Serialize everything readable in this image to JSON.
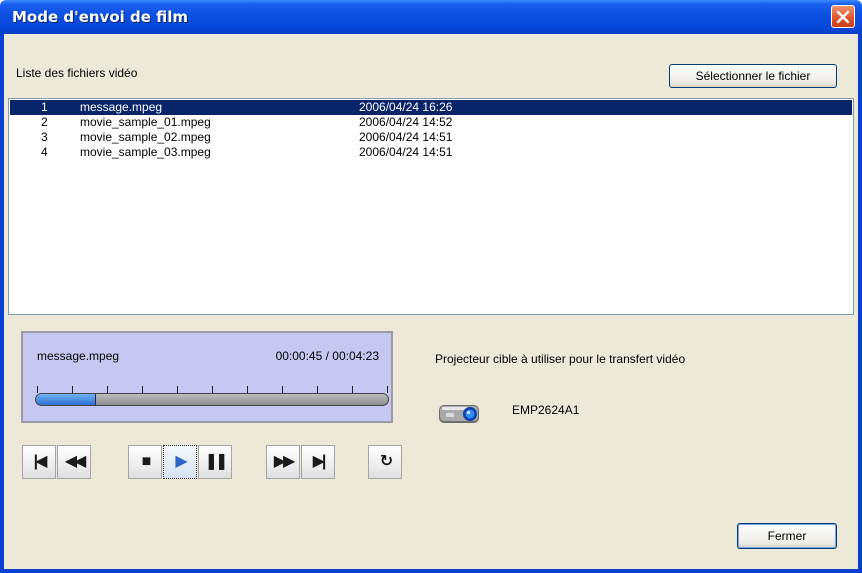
{
  "window": {
    "title": "Mode d'envoi de film"
  },
  "files": {
    "label": "Liste des fichiers vidéo",
    "select_button": "Sélectionner le fichier",
    "rows": [
      {
        "num": "1",
        "name": "message.mpeg",
        "date": "2006/04/24 16:26",
        "selected": true
      },
      {
        "num": "2",
        "name": "movie_sample_01.mpeg",
        "date": "2006/04/24 14:52",
        "selected": false
      },
      {
        "num": "3",
        "name": "movie_sample_02.mpeg",
        "date": "2006/04/24 14:51",
        "selected": false
      },
      {
        "num": "4",
        "name": "movie_sample_03.mpeg",
        "date": "2006/04/24 14:51",
        "selected": false
      }
    ]
  },
  "player": {
    "file": "message.mpeg",
    "time": "00:00:45 / 00:04:23",
    "progress_fraction": 0.171,
    "controls": [
      {
        "name": "skip-start-icon",
        "glyph": "|◀",
        "active": false
      },
      {
        "name": "rewind-icon",
        "glyph": "◀◀",
        "active": false
      },
      {
        "name": "stop-icon",
        "glyph": "■",
        "active": false
      },
      {
        "name": "play-icon",
        "glyph": "▶",
        "active": true
      },
      {
        "name": "pause-icon",
        "glyph": "❚❚",
        "active": false
      },
      {
        "name": "fast-forward-icon",
        "glyph": "▶▶",
        "active": false
      },
      {
        "name": "skip-end-icon",
        "glyph": "▶|",
        "active": false
      },
      {
        "name": "repeat-icon",
        "glyph": "↻",
        "active": false
      }
    ]
  },
  "projector": {
    "label": "Projecteur cible à utiliser pour le transfert vidéo",
    "name": "EMP2624A1",
    "icon": "projector-icon"
  },
  "footer": {
    "close_button": "Fermer"
  },
  "colors": {
    "titlebar": "#0a4ee0",
    "selection": "#0a246a",
    "player_bg": "#c7c8f2",
    "progress": "#2e6fd1"
  }
}
